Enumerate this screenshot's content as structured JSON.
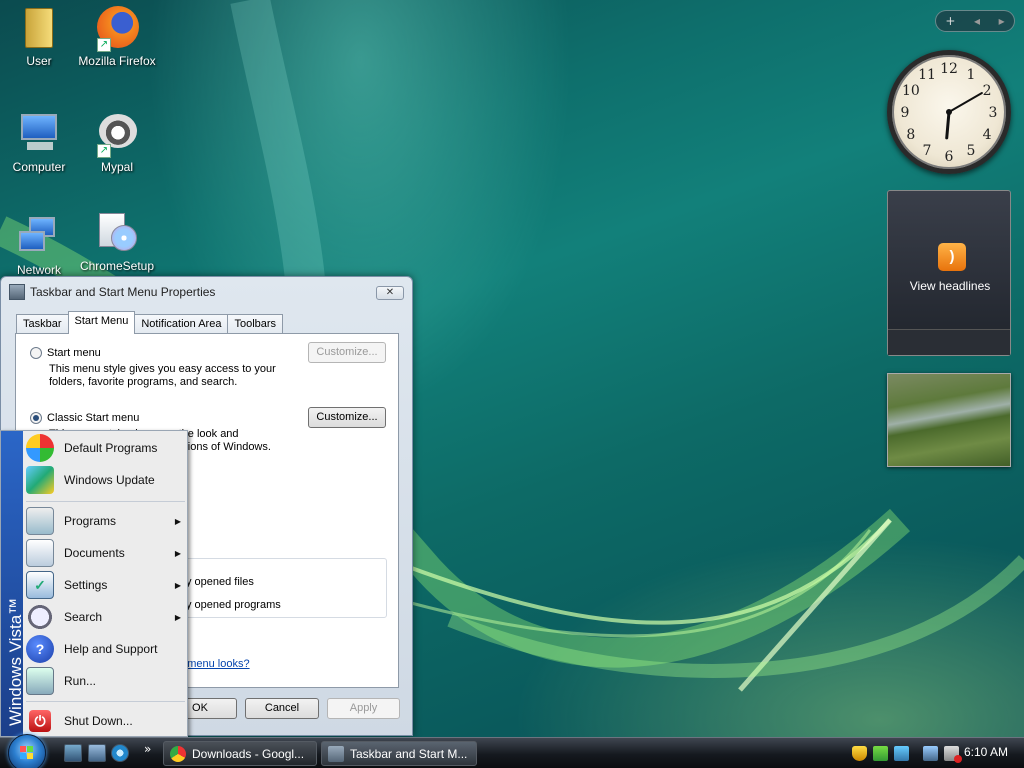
{
  "desktop": {
    "icons": [
      {
        "label": "User",
        "icon": "folder-icon"
      },
      {
        "label": "Mozilla Firefox",
        "icon": "firefox-icon"
      },
      {
        "label": "Computer",
        "icon": "computer-icon"
      },
      {
        "label": "Mypal",
        "icon": "mypal-icon"
      },
      {
        "label": "Network",
        "icon": "network-icon"
      },
      {
        "label": "ChromeSetup",
        "icon": "installer-icon"
      }
    ]
  },
  "sidebar": {
    "controls": {
      "add": "+",
      "prev": "◂",
      "next": "▸"
    },
    "clock_numbers": [
      "12",
      "1",
      "2",
      "3",
      "4",
      "5",
      "6",
      "7",
      "8",
      "9",
      "10",
      "11"
    ],
    "clock_time": {
      "hour": 6,
      "minute": 10
    },
    "feed": {
      "text": "View headlines",
      "icon": "rss-icon"
    },
    "slideshow": {
      "icon": "photo-slideshow"
    }
  },
  "dialog": {
    "title": "Taskbar and Start Menu Properties",
    "close": "✕",
    "tabs": [
      "Taskbar",
      "Start Menu",
      "Notification Area",
      "Toolbars"
    ],
    "selected_tab": "Start Menu",
    "options": {
      "start_menu": {
        "label": "Start menu",
        "desc_line1": "This menu style gives you easy access to your",
        "desc_line2": "folders, favorite programs, and search.",
        "customize": "Customize...",
        "selected": false
      },
      "classic": {
        "label": "Classic Start menu",
        "desc_line1": "This menu style gives you the look and",
        "desc_line2": "functionality of previous versions of Windows.",
        "customize": "Customize...",
        "selected": true
      }
    },
    "privacy": {
      "item1": "Store and display a list of recently opened files",
      "item2": "Store and display a list of recently opened programs"
    },
    "link": "How do I change the way the Start menu looks?",
    "buttons": {
      "ok": "OK",
      "cancel": "Cancel",
      "apply": "Apply"
    }
  },
  "start_menu": {
    "brand": "Windows Vista™",
    "pinned": [
      {
        "label": "Default Programs",
        "icon": "default-programs-icon"
      },
      {
        "label": "Windows Update",
        "icon": "windows-update-icon"
      }
    ],
    "items": [
      {
        "label": "Programs",
        "icon": "programs-icon",
        "submenu": true
      },
      {
        "label": "Documents",
        "icon": "documents-icon",
        "submenu": true
      },
      {
        "label": "Settings",
        "icon": "settings-icon",
        "submenu": true
      },
      {
        "label": "Search",
        "icon": "search-icon",
        "submenu": true
      },
      {
        "label": "Help and Support",
        "icon": "help-icon",
        "submenu": false
      },
      {
        "label": "Run...",
        "icon": "run-icon",
        "submenu": false
      }
    ],
    "shutdown": {
      "label": "Shut Down...",
      "icon": "shutdown-icon"
    },
    "arrow": "▶"
  },
  "taskbar": {
    "quick_launch": [
      "show-desktop-icon",
      "switch-windows-icon",
      "internet-explorer-icon"
    ],
    "overflow": "»",
    "buttons": [
      {
        "label": "Downloads - Googl...",
        "icon": "chrome-icon"
      },
      {
        "label": "Taskbar and Start M...",
        "icon": "properties-icon"
      }
    ],
    "tray_icons": [
      "shield-icon",
      "network-tray-icon",
      "update-icon",
      "display-icon",
      "volume-muted-icon"
    ],
    "clock": "6:10 AM"
  }
}
